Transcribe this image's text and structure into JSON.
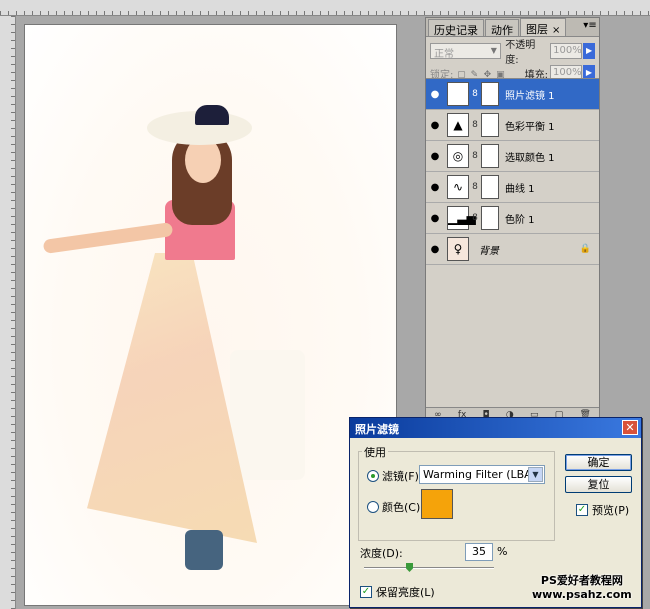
{
  "layers_panel": {
    "tabs": [
      {
        "label": "历史记录"
      },
      {
        "label": "动作"
      },
      {
        "label": "图层",
        "close": "×"
      }
    ],
    "blend_mode": "正常",
    "opacity_label": "不透明度:",
    "opacity_value": "100%",
    "lock_label": "锁定:",
    "fill_label": "填充:",
    "fill_value": "100%",
    "layers": [
      {
        "name": "照片滤镜 1",
        "selected": true,
        "thumb": "photo-filter-icon"
      },
      {
        "name": "色彩平衡 1",
        "thumb": "color-balance-icon"
      },
      {
        "name": "选取颜色 1",
        "thumb": "selective-color-icon"
      },
      {
        "name": "曲线 1",
        "thumb": "curves-icon"
      },
      {
        "name": "色阶 1",
        "thumb": "levels-icon"
      },
      {
        "name": "背景",
        "thumb": "image-thumbnail",
        "locked": true
      }
    ]
  },
  "dialog": {
    "title": "照片滤镜",
    "group_title": "使用",
    "filter_label": "滤镜(F):",
    "filter_value": "Warming Filter (LBA)",
    "color_label": "颜色(C):",
    "color_value": "#f5a30a",
    "ok_label": "确定",
    "reset_label": "复位",
    "preview_label": "预览(P)",
    "density_label": "浓度(D):",
    "density_value": "35",
    "density_unit": "%",
    "preserve_label": "保留亮度(L)",
    "close_glyph": "✕",
    "check_glyph": "✓"
  },
  "watermark": {
    "line1": "PS爱好者教程网",
    "line2": "www.psahz.com"
  },
  "colors": {
    "selection": "#3169c6",
    "title_bar": "#0a3b9c",
    "dialog_bg": "#ece9d8"
  }
}
